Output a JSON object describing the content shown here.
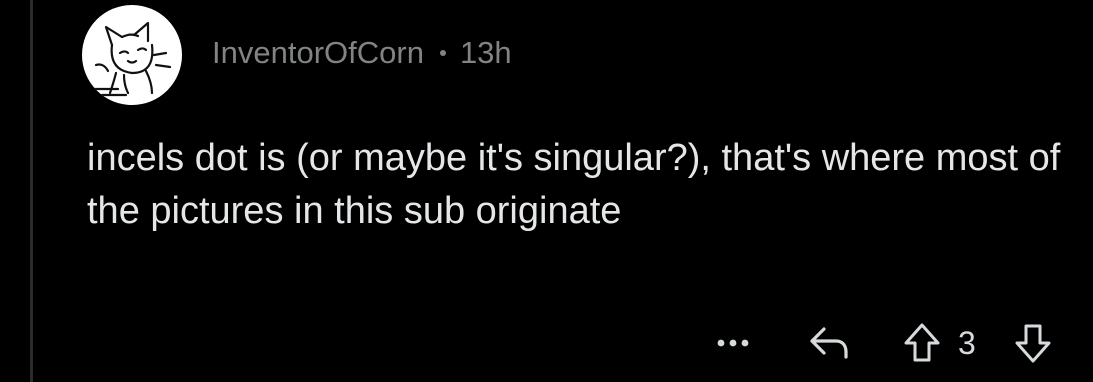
{
  "comment": {
    "username": "InventorOfCorn",
    "separator": "·",
    "age": "13h",
    "text": "incels dot is (or maybe it's singular?), that's where most of the pictures in this sub originate",
    "score": "3"
  },
  "icons": {
    "avatar": "cat-doodle-avatar",
    "more": "more-dots-icon",
    "reply": "reply-arrow-icon",
    "upvote": "upvote-arrow-icon",
    "downvote": "downvote-arrow-icon"
  },
  "colors": {
    "background": "#000000",
    "meta": "#818384",
    "text": "#e4e6e8",
    "thread_line": "#2b2b2b"
  }
}
